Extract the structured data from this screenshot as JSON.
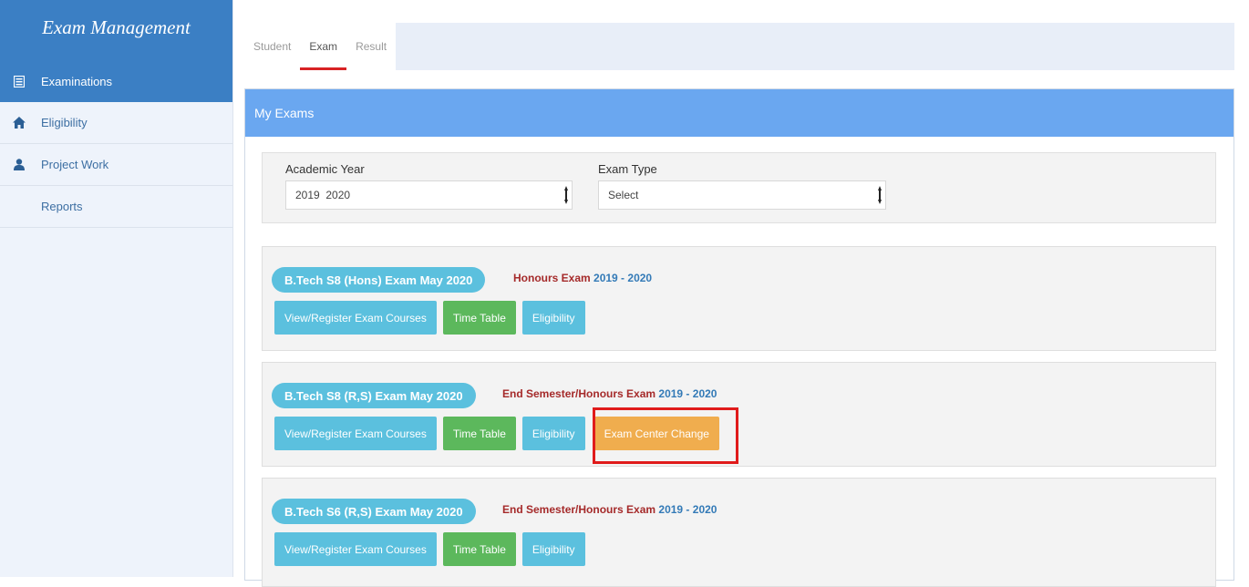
{
  "sidebar": {
    "brand": "Exam Management",
    "items": [
      {
        "label": "Examinations",
        "icon": "list-icon",
        "active": true
      },
      {
        "label": "Eligibility",
        "icon": "home-icon",
        "active": false
      },
      {
        "label": "Project Work",
        "icon": "user-icon",
        "active": false
      },
      {
        "label": "Reports",
        "icon": "",
        "active": false
      }
    ]
  },
  "tabs": [
    {
      "label": "Student",
      "active": false
    },
    {
      "label": "Exam",
      "active": true
    },
    {
      "label": "Result",
      "active": false
    }
  ],
  "panel": {
    "title": "My Exams",
    "filters": {
      "academic_year_label": "Academic Year",
      "academic_year_value": "2019  2020",
      "exam_type_label": "Exam Type",
      "exam_type_value": "Select"
    },
    "exams": [
      {
        "name": "B.Tech S8 (Hons) Exam May 2020",
        "type": "Honours Exam",
        "year": "2019 - 2020",
        "buttons": [
          "View/Register Exam Courses",
          "Time Table",
          "Eligibility"
        ]
      },
      {
        "name": "B.Tech S8 (R,S) Exam May 2020",
        "type": "End Semester/Honours Exam",
        "year": "2019 - 2020",
        "buttons": [
          "View/Register Exam Courses",
          "Time Table",
          "Eligibility",
          "Exam Center Change"
        ]
      },
      {
        "name": "B.Tech S6 (R,S) Exam May 2020",
        "type": "End Semester/Honours Exam",
        "year": "2019 - 2020",
        "buttons": [
          "View/Register Exam Courses",
          "Time Table",
          "Eligibility"
        ]
      }
    ]
  },
  "colors": {
    "brand_blue": "#3b7fc4",
    "panel_header": "#6aa7f0",
    "info": "#5bc0de",
    "success": "#5cb85c",
    "warning": "#f0ad4e",
    "highlight": "#e01b1b",
    "exam_type_text": "#a52a2a",
    "year_text": "#337ab7"
  }
}
